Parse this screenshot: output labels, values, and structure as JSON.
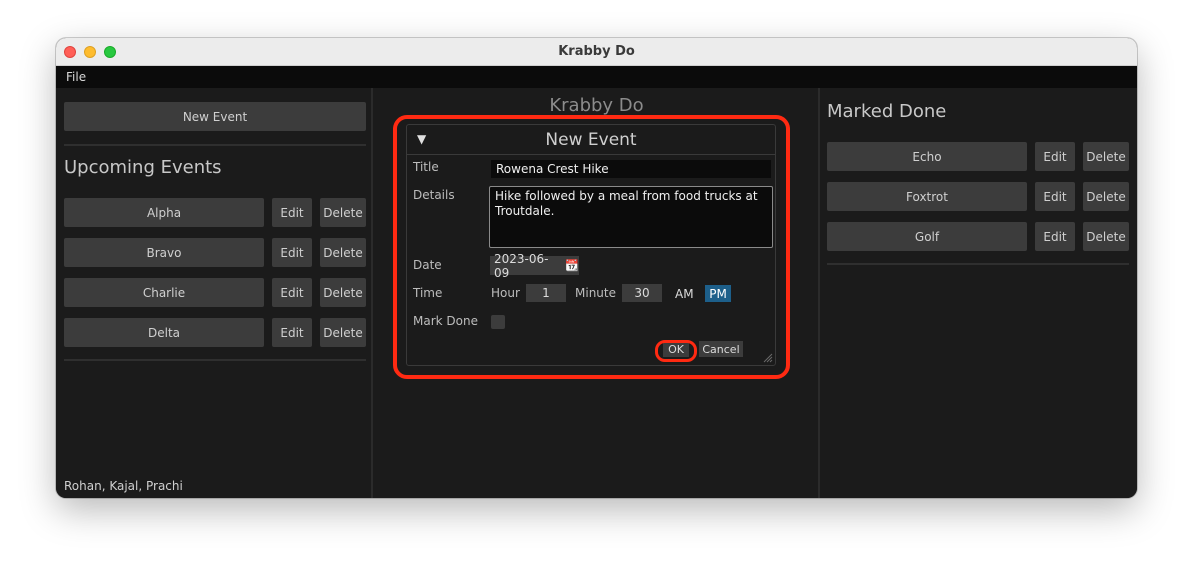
{
  "window": {
    "title": "Krabby Do"
  },
  "menu": {
    "file": "File"
  },
  "left": {
    "new_event_label": "New Event",
    "section_title": "Upcoming Events",
    "events": [
      {
        "name": "Alpha",
        "edit": "Edit",
        "delete": "Delete"
      },
      {
        "name": "Bravo",
        "edit": "Edit",
        "delete": "Delete"
      },
      {
        "name": "Charlie",
        "edit": "Edit",
        "delete": "Delete"
      },
      {
        "name": "Delta",
        "edit": "Edit",
        "delete": "Delete"
      }
    ],
    "footer": "Rohan, Kajal, Prachi"
  },
  "center": {
    "title": "Krabby Do"
  },
  "modal": {
    "title": "New Event",
    "collapse_glyph": "▼",
    "title_label": "Title",
    "title_value": "Rowena Crest Hike",
    "details_label": "Details",
    "details_value": "Hike followed by a meal from food trucks at Troutdale.",
    "date_label": "Date",
    "date_value": "2023-06-09",
    "calendar_glyph": "📆",
    "time_label": "Time",
    "hour_label": "Hour",
    "hour_value": "1",
    "minute_label": "Minute",
    "minute_value": "30",
    "am_label": "AM",
    "pm_label": "PM",
    "mark_done_label": "Mark Done",
    "ok_label": "OK",
    "cancel_label": "Cancel"
  },
  "right": {
    "section_title": "Marked Done",
    "events": [
      {
        "name": "Echo",
        "edit": "Edit",
        "delete": "Delete"
      },
      {
        "name": "Foxtrot",
        "edit": "Edit",
        "delete": "Delete"
      },
      {
        "name": "Golf",
        "edit": "Edit",
        "delete": "Delete"
      }
    ]
  },
  "colors": {
    "highlight": "#ff2a12",
    "pm_active": "#1d5f8a",
    "window_bg": "#1b1b1b"
  }
}
